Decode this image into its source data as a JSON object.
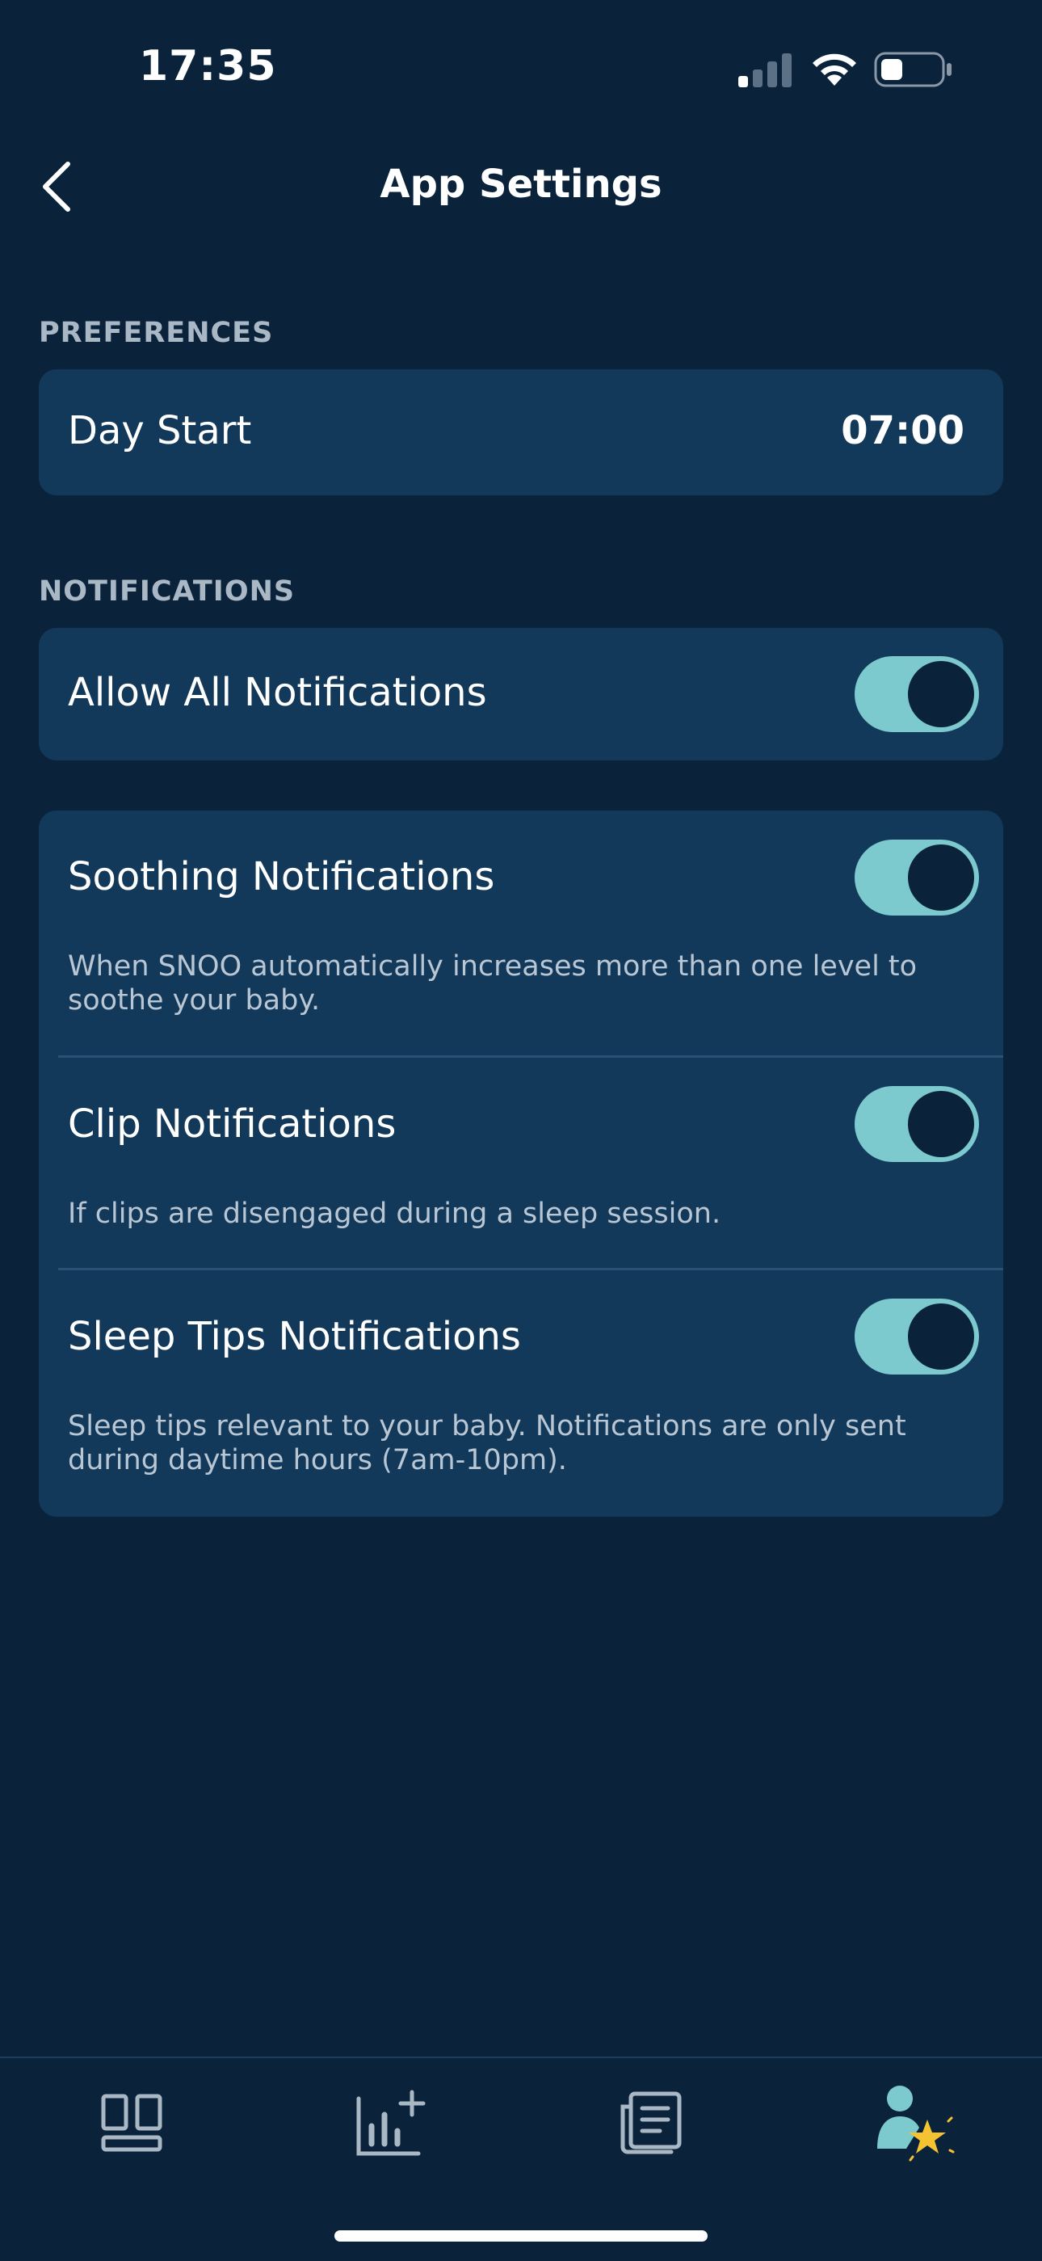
{
  "status_bar": {
    "time": "17:35"
  },
  "header": {
    "title": "App Settings"
  },
  "preferences": {
    "section_title": "PREFERENCES",
    "day_start": {
      "label": "Day Start",
      "value": "07:00"
    }
  },
  "notifications": {
    "section_title": "NOTIFICATIONS",
    "allow_all": {
      "label": "Allow All Notifications",
      "enabled": true
    },
    "items": [
      {
        "label": "Soothing Notifications",
        "description": "When SNOO automatically increases more than one level to soothe your baby.",
        "enabled": true
      },
      {
        "label": "Clip Notifications",
        "description": "If clips are disengaged during a sleep session.",
        "enabled": true
      },
      {
        "label": "Sleep Tips Notifications",
        "description": "Sleep tips relevant to your baby. Notifications are only sent during daytime hours (7am-10pm).",
        "enabled": true
      }
    ]
  },
  "tab_bar": {
    "tabs": [
      {
        "icon": "dashboard-icon"
      },
      {
        "icon": "stats-add-icon"
      },
      {
        "icon": "articles-icon"
      },
      {
        "icon": "profile-star-icon"
      }
    ]
  },
  "colors": {
    "background": "#0a233b",
    "card": "#12395a",
    "toggle_on": "#7cc9ce",
    "star": "#f5c232"
  }
}
